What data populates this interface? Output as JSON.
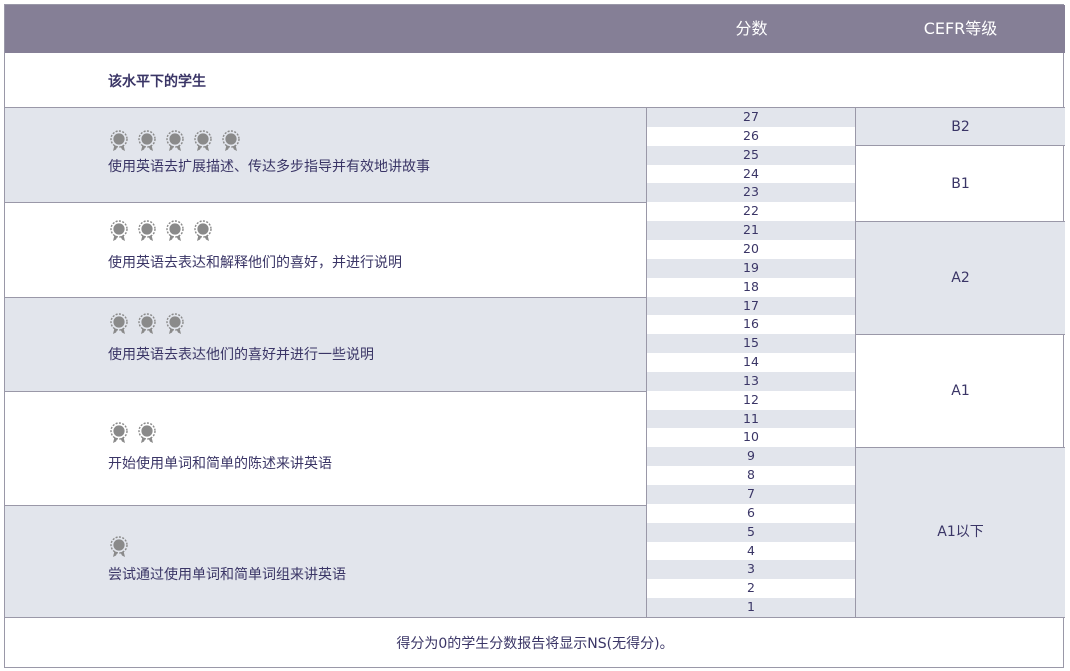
{
  "header": {
    "score_label": "分数",
    "cefr_label": "CEFR等级"
  },
  "subhead": {
    "label": "该水平下的学生"
  },
  "bands": [
    {
      "stars": 5,
      "text": "使用英语去扩展描述、传达多步指导并有效地讲故事"
    },
    {
      "stars": 4,
      "text": "使用英语去表达和解释他们的喜好，并进行说明"
    },
    {
      "stars": 3,
      "text": "使用英语去表达他们的喜好并进行一些说明"
    },
    {
      "stars": 2,
      "text": "开始使用单词和简单的陈述来讲英语"
    },
    {
      "stars": 1,
      "text": "尝试通过使用单词和简单词组来讲英语"
    }
  ],
  "scores": [
    "27",
    "26",
    "25",
    "24",
    "23",
    "22",
    "21",
    "20",
    "19",
    "18",
    "17",
    "16",
    "15",
    "14",
    "13",
    "12",
    "11",
    "10",
    "9",
    "8",
    "7",
    "6",
    "5",
    "4",
    "3",
    "2",
    "1"
  ],
  "cefr_levels": [
    {
      "label": "B2"
    },
    {
      "label": "B1"
    },
    {
      "label": "A2"
    },
    {
      "label": "A1"
    },
    {
      "label": "A1以下"
    }
  ],
  "footer": {
    "note": "得分为0的学生分数报告将显示NS(无得分)。"
  },
  "colors": {
    "header_bg": "#857f96",
    "shade": "#e2e5ec",
    "text": "#3a3566",
    "medal": "#8a8a8a"
  },
  "icons": {
    "medal": "medal-icon"
  }
}
